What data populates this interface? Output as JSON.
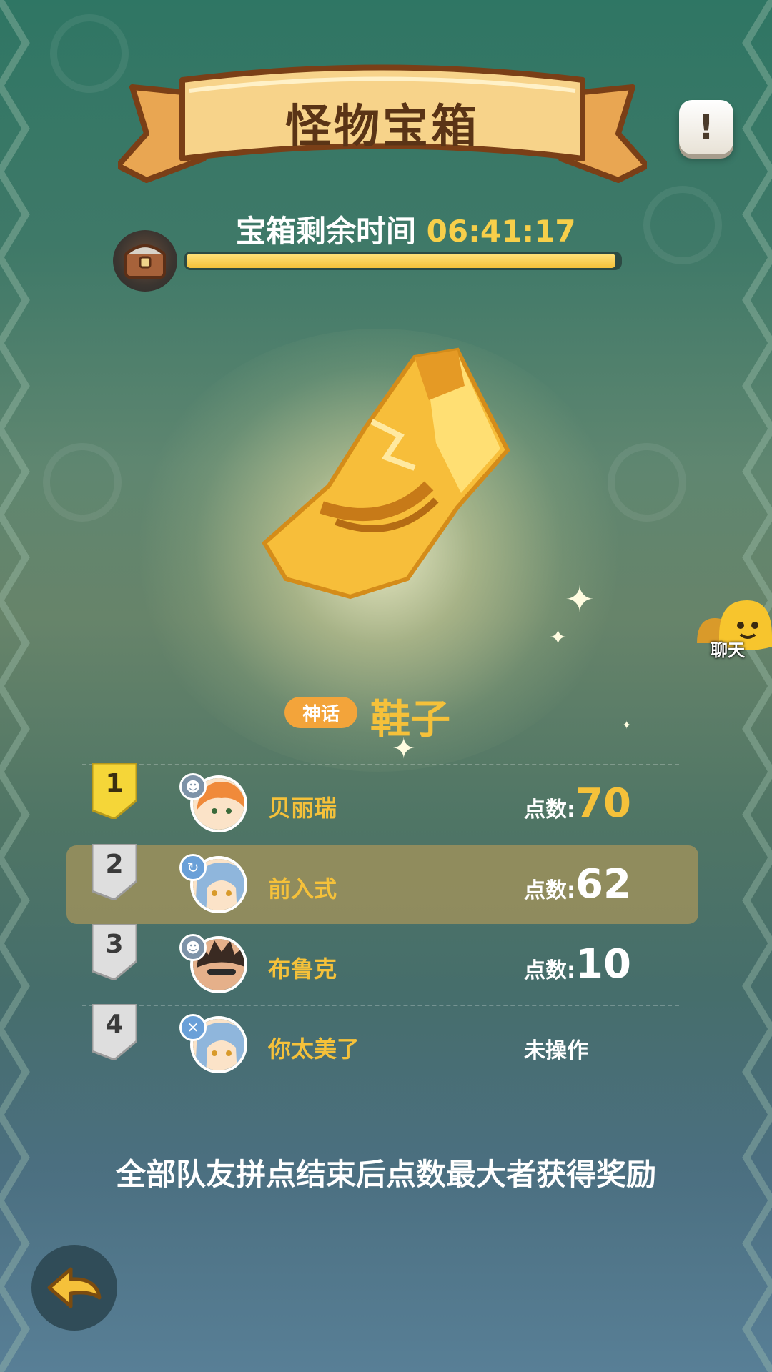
{
  "header": {
    "title": "怪物宝箱"
  },
  "info_button": {
    "icon": "exclamation-icon",
    "label": "!"
  },
  "timer": {
    "label": "宝箱剩余时间",
    "value": "06:41:17",
    "progress": 0.99
  },
  "item": {
    "rarity": "神话",
    "name": "鞋子",
    "icon": "golden-boot-icon"
  },
  "chat": {
    "label": "聊天"
  },
  "leaderboard": {
    "score_label": "点数:",
    "rows": [
      {
        "rank": "1",
        "name": "贝丽瑞",
        "score": "70",
        "status": "",
        "highlight": false
      },
      {
        "rank": "2",
        "name": "前入式",
        "score": "62",
        "status": "",
        "highlight": true
      },
      {
        "rank": "3",
        "name": "布鲁克",
        "score": "10",
        "status": "",
        "highlight": false
      },
      {
        "rank": "4",
        "name": "你太美了",
        "score": "",
        "status": "未操作",
        "highlight": false
      }
    ]
  },
  "footer": {
    "note": "全部队友拼点结束后点数最大者获得奖励"
  },
  "colors": {
    "accent": "#f5c13a",
    "rarity": "#f3a43a",
    "highlight": "#aa965a"
  }
}
